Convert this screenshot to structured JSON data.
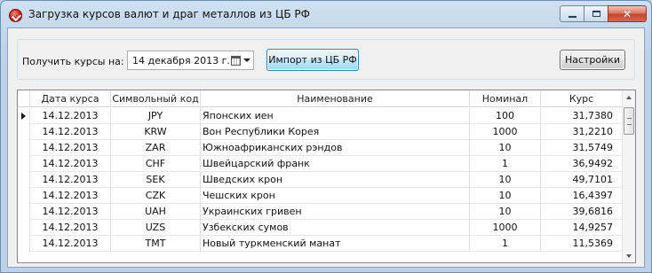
{
  "window": {
    "title": "Загрузка курсов валют и драг металлов из ЦБ РФ",
    "close_glyph": "✕"
  },
  "toolbar": {
    "get_rates_label": "Получить курсы на:",
    "date_value": "14 декабря 2013 г.",
    "import_button": "Импорт из ЦБ РФ",
    "settings_button": "Настройки"
  },
  "grid": {
    "columns": [
      "Дата курса",
      "Символьный код",
      "Наименование",
      "Номинал",
      "Курс"
    ],
    "rows": [
      [
        "14.12.2013",
        "JPY",
        "Японских иен",
        "100",
        "31,7380"
      ],
      [
        "14.12.2013",
        "KRW",
        "Вон Республики Корея",
        "1000",
        "31,2210"
      ],
      [
        "14.12.2013",
        "ZAR",
        "Южноафриканских рэндов",
        "10",
        "31,5749"
      ],
      [
        "14.12.2013",
        "CHF",
        "Швейцарский франк",
        "1",
        "36,9492"
      ],
      [
        "14.12.2013",
        "SEK",
        "Шведских крон",
        "10",
        "49,7101"
      ],
      [
        "14.12.2013",
        "CZK",
        "Чешских крон",
        "10",
        "16,4397"
      ],
      [
        "14.12.2013",
        "UAH",
        "Украинских гривен",
        "10",
        "39,6816"
      ],
      [
        "14.12.2013",
        "UZS",
        "Узбекских сумов",
        "1000",
        "14,9257"
      ],
      [
        "14.12.2013",
        "TMT",
        "Новый туркменский манат",
        "1",
        "11,5369"
      ]
    ]
  },
  "colors": {
    "import_button_border": "#3c7fb1",
    "close_button": "#c4422a"
  }
}
